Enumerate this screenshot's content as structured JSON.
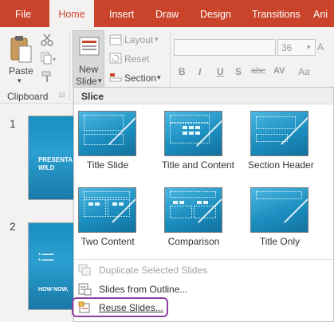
{
  "tabs": [
    {
      "label": "File",
      "active": false
    },
    {
      "label": "Home",
      "active": true
    },
    {
      "label": "Insert",
      "active": false
    },
    {
      "label": "Draw",
      "active": false
    },
    {
      "label": "Design",
      "active": false
    },
    {
      "label": "Transitions",
      "active": false
    },
    {
      "label": "Ani",
      "active": false
    }
  ],
  "ribbon": {
    "paste_label": "Paste",
    "clipboard_group": "Clipboard",
    "new_slide_line1": "New",
    "new_slide_line2": "Slide",
    "layout_label": "Layout",
    "reset_label": "Reset",
    "section_label": "Section",
    "font_size_value": "36",
    "format_buttons": [
      "B",
      "I",
      "U",
      "S",
      "abc",
      "AV",
      "Aa"
    ]
  },
  "thumbnails": {
    "numbers": [
      "1",
      "2"
    ],
    "slide1_title": "PRESENTA\nWILD",
    "slide2_title": "HOW NOW,"
  },
  "dropdown": {
    "theme_name": "Slice",
    "layouts": [
      {
        "label": "Title Slide"
      },
      {
        "label": "Title and Content"
      },
      {
        "label": "Section Header"
      },
      {
        "label": "Two Content"
      },
      {
        "label": "Comparison"
      },
      {
        "label": "Title Only"
      }
    ],
    "menu_items": [
      {
        "label": "Duplicate Selected Slides",
        "disabled": true
      },
      {
        "label": "Slides from Outline...",
        "disabled": false
      },
      {
        "label": "Reuse Slides...",
        "disabled": false
      }
    ]
  },
  "colors": {
    "tab_bar": "#c9442b",
    "ribbon_bg": "#f4f2f1",
    "slide_blue": "#1b8fc0",
    "highlight": "#8e3fa4"
  }
}
